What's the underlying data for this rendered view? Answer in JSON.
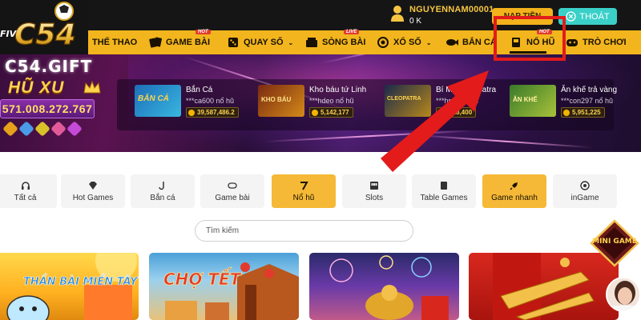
{
  "header": {
    "username": "NGUYENNAM00001",
    "balance": "0 K",
    "deposit_label": "NẠP TIỀN",
    "logout_label": "THOÁT"
  },
  "logo": {
    "text": "C54",
    "prefix": "FIV"
  },
  "nav": {
    "items": [
      {
        "label": "THỂ THAO",
        "icon": "sports-icon"
      },
      {
        "label": "GAME BÀI",
        "icon": "cards-icon",
        "tag": "HOT"
      },
      {
        "label": "QUAY SỐ",
        "icon": "dice-icon",
        "chevron": "⌄"
      },
      {
        "label": "SÒNG BÀI",
        "icon": "casino-icon",
        "tag": "LIVE"
      },
      {
        "label": "XỔ SỐ",
        "icon": "lottery-icon",
        "chevron": "⌄"
      },
      {
        "label": "BẮN CÁ",
        "icon": "fish-icon"
      },
      {
        "label": "NỔ HŨ",
        "icon": "slot-machine-icon",
        "tag": "HOT",
        "active": true
      },
      {
        "label": "TRÒ CHƠI",
        "icon": "gamepad-icon"
      }
    ]
  },
  "banner": {
    "site_name": "C54.GIFT",
    "jackpot_title": "HŨ XU",
    "jackpot_amount": "571.008.272.767"
  },
  "winners": [
    {
      "game": "Bắn Cá",
      "user": "***ca600 nổ hũ",
      "amount": "39,587,486.2",
      "thumb_text": "BẮN CÁ"
    },
    {
      "game": "Kho báu tứ Linh",
      "user": "***hdeo nổ hũ",
      "amount": "5,142,177",
      "thumb_text": "KHO BÁU"
    },
    {
      "game": "Bí Mật Cleopatra",
      "user": "***hp... nổ hũ",
      "amount": "...18,400",
      "thumb_text": "CLEOPATRA"
    },
    {
      "game": "Ăn khế trả vàng",
      "user": "***con297 nổ hũ",
      "amount": "5,951,225",
      "thumb_text": "ĂN KHẾ"
    }
  ],
  "categories": [
    {
      "label": "Tất cả",
      "icon": "headset-icon"
    },
    {
      "label": "Hot Games",
      "icon": "diamond-icon"
    },
    {
      "label": "Bắn cá",
      "icon": "fish-hook-icon"
    },
    {
      "label": "Game bài",
      "icon": "cards-icon"
    },
    {
      "label": "Nổ hũ",
      "icon": "seven-icon",
      "active": true
    },
    {
      "label": "Slots",
      "icon": "slots-icon"
    },
    {
      "label": "Table Games",
      "icon": "table-icon"
    },
    {
      "label": "Game nhanh",
      "icon": "rocket-icon",
      "active": true
    },
    {
      "label": "inGame",
      "icon": "ingame-icon"
    }
  ],
  "search": {
    "placeholder": "Tìm kiếm"
  },
  "tiles": [
    {
      "title": "THẦN BÀI MIỀN TÂY"
    },
    {
      "title": "CHỢ TẾT"
    },
    {
      "title": ""
    },
    {
      "title": ""
    }
  ],
  "mini_game": {
    "label": "MINI GAME"
  },
  "colors": {
    "nav_bg": "#f2b51d",
    "topbar_bg": "#151515",
    "accent_red": "#e31b1b",
    "deposit": "#f3b21b",
    "logout": "#3ad0c8"
  }
}
